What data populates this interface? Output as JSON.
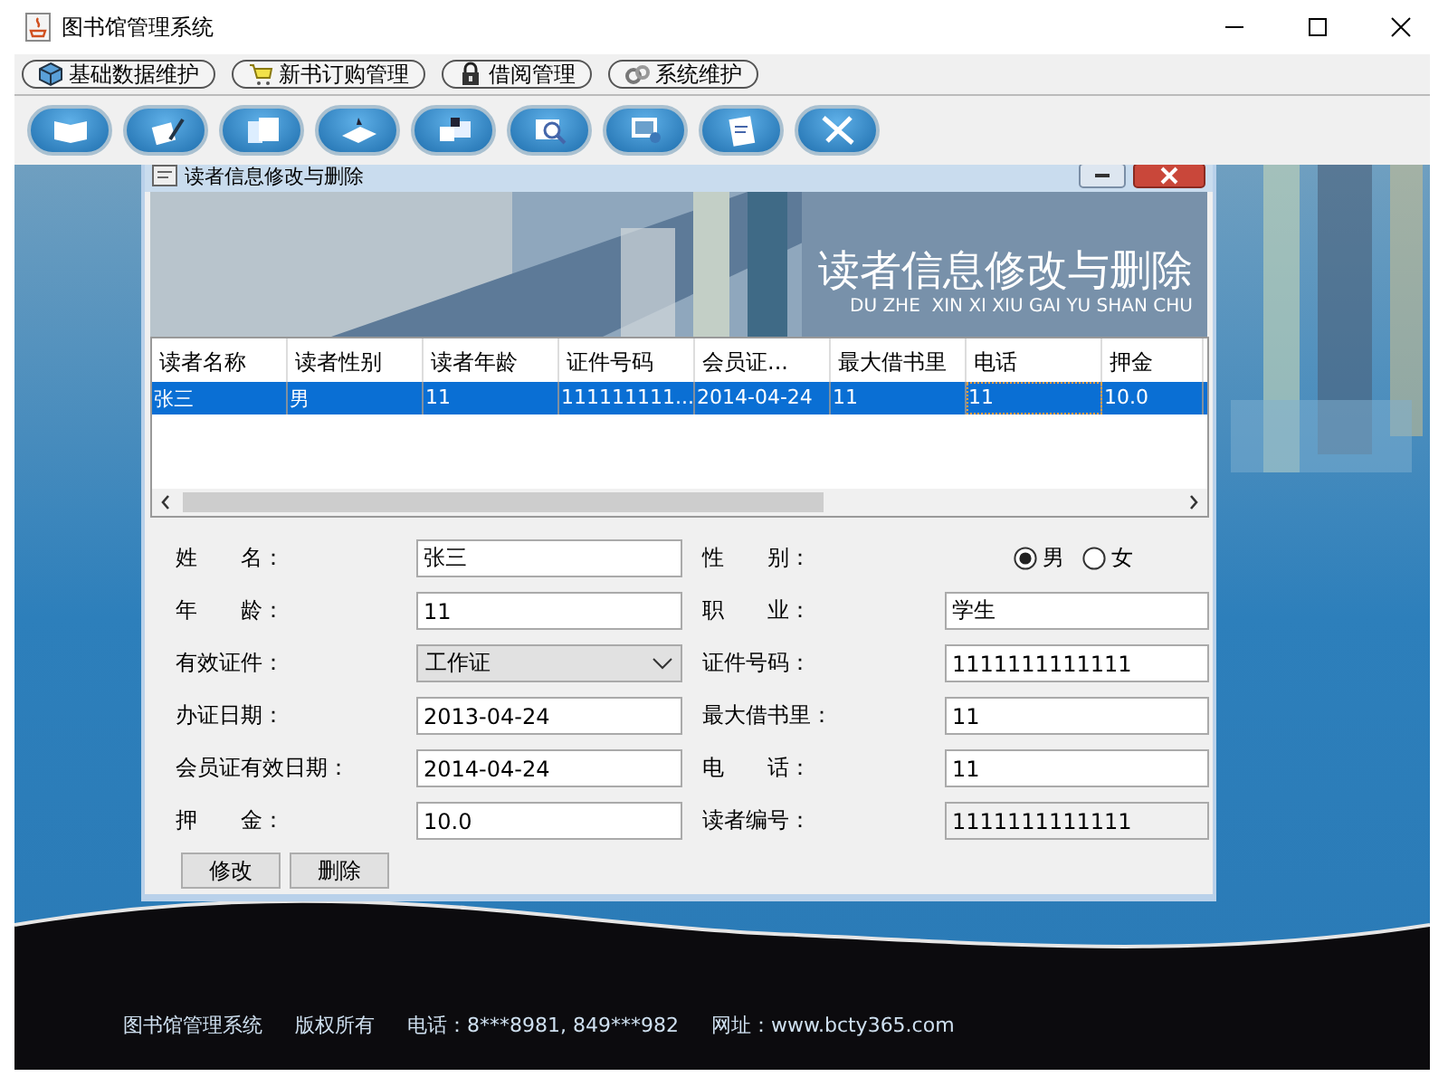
{
  "window": {
    "title": "图书馆管理系统"
  },
  "menus": [
    {
      "label": "基础数据维护"
    },
    {
      "label": "新书订购管理"
    },
    {
      "label": "借阅管理"
    },
    {
      "label": "系统维护"
    }
  ],
  "footer": {
    "texts": [
      "图书馆管理系统",
      "版权所有",
      "电话：8***8981, 849***982",
      "网址：www.bcty365.com"
    ]
  },
  "frame": {
    "title": "读者信息修改与删除",
    "banner": {
      "title": "读者信息修改与删除",
      "subtitle": "DU ZHE  XIN XI XIU GAI YU SHAN CHU"
    },
    "table": {
      "columns": [
        "读者名称",
        "读者性别",
        "读者年龄",
        "证件号码",
        "会员证...",
        "最大借书里",
        "电话",
        "押金"
      ],
      "rows": [
        {
          "selected": true,
          "cells": [
            {
              "text": "张三",
              "focused": false
            },
            {
              "text": "男",
              "focused": false
            },
            {
              "text": "11",
              "focused": false
            },
            {
              "text": "111111111...",
              "focused": false
            },
            {
              "text": "2014-04-24",
              "focused": false
            },
            {
              "text": "11",
              "focused": false
            },
            {
              "text": "11",
              "focused": true
            },
            {
              "text": "10.0",
              "focused": false
            }
          ]
        }
      ]
    },
    "form": [
      {
        "label": "姓　　名：",
        "kind": "text",
        "value": "张三"
      },
      {
        "label": "性　　别：",
        "kind": "radio",
        "options": [
          {
            "label": "男",
            "selected": true
          },
          {
            "label": "女",
            "selected": false
          }
        ]
      },
      {
        "label": "年　　龄：",
        "kind": "text",
        "value": "11"
      },
      {
        "label": "职　　业：",
        "kind": "text",
        "value": "学生"
      },
      {
        "label": "有效证件：",
        "kind": "select",
        "value": "工作证"
      },
      {
        "label": "证件号码：",
        "kind": "text",
        "value": "1111111111111"
      },
      {
        "label": "办证日期：",
        "kind": "text",
        "value": "2013-04-24"
      },
      {
        "label": "最大借书里：",
        "kind": "text",
        "value": "11"
      },
      {
        "label": "会员证有效日期：",
        "kind": "text",
        "value": "2014-04-24"
      },
      {
        "label": "电　　话：",
        "kind": "text",
        "value": "11"
      },
      {
        "label": "押　　金：",
        "kind": "text",
        "value": "10.0"
      },
      {
        "label": "读者编号：",
        "kind": "readonly",
        "value": "1111111111111"
      }
    ],
    "buttons": [
      "修改",
      "删除"
    ]
  }
}
